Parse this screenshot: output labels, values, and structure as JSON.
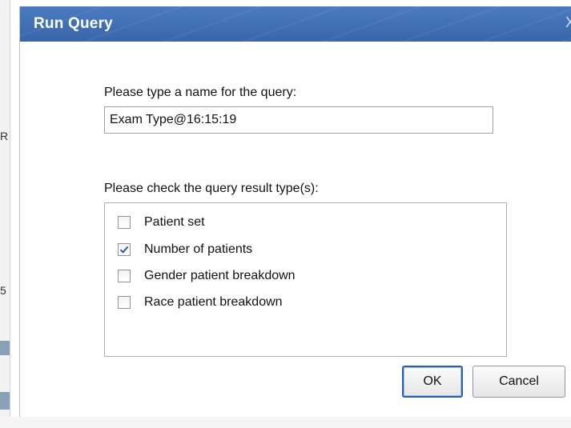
{
  "background": {
    "edge_glyphs": [
      "R",
      "5"
    ]
  },
  "dialog": {
    "title": "Run Query",
    "close_glyph": "X",
    "name_prompt": "Please type a name for the query:",
    "query_name": "Exam Type@16:15:19",
    "types_prompt": "Please check the query result type(s):",
    "result_types": [
      {
        "label": "Patient set",
        "checked": false
      },
      {
        "label": "Number of patients",
        "checked": true
      },
      {
        "label": "Gender patient breakdown",
        "checked": false
      },
      {
        "label": "Race patient breakdown",
        "checked": false
      }
    ],
    "ok_label": "OK",
    "cancel_label": "Cancel"
  },
  "colors": {
    "titlebar": "#3f6fb5",
    "check_mark": "#2a5aa0",
    "ok_border": "#2b5fa8"
  }
}
